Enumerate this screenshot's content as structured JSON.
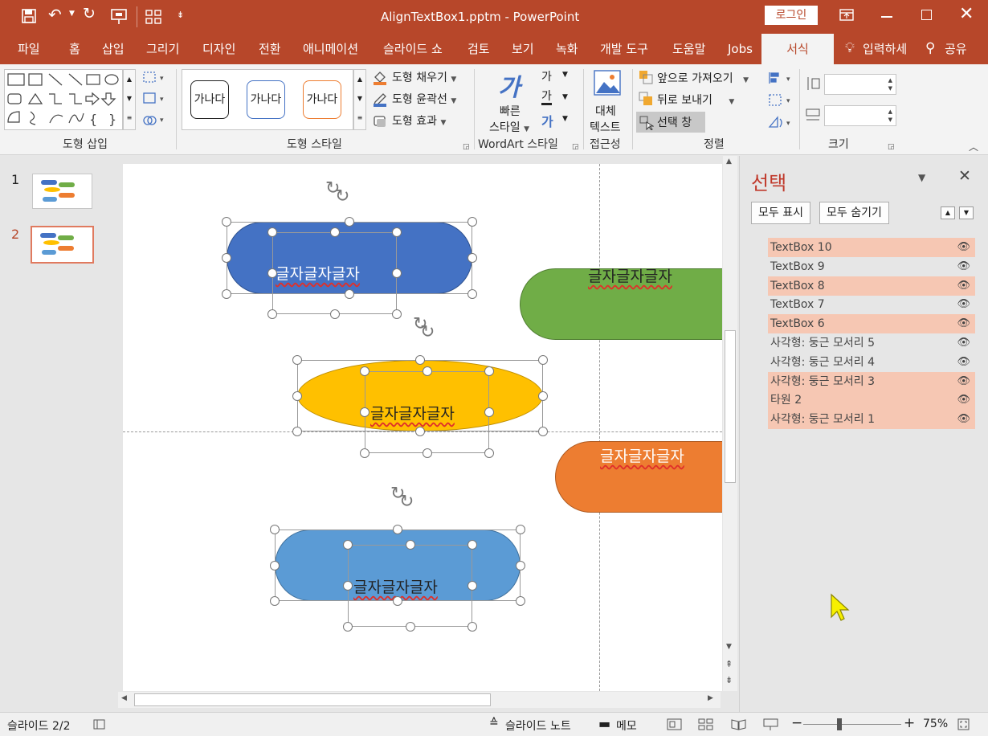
{
  "title": {
    "text": "AlignTextBox1.pptm  -  PowerPoint",
    "login": "로그인"
  },
  "tabs": [
    "파일",
    "홈",
    "삽입",
    "그리기",
    "디자인",
    "전환",
    "애니메이션",
    "슬라이드 쇼",
    "검토",
    "보기",
    "녹화",
    "개발 도구",
    "도움말",
    "Jobs",
    "서식"
  ],
  "tell_me": "입력하세",
  "share": "공유",
  "ribbon": {
    "groups": [
      "도형 삽입",
      "도형 스타일",
      "WordArt 스타일",
      "접근성",
      "정렬",
      "크기"
    ],
    "style_presets": [
      "가나다",
      "가나다",
      "가나다"
    ],
    "fill": "도형 채우기",
    "outline": "도형 윤곽선",
    "effects": "도형 효과",
    "quick_style_1": "빠른",
    "quick_style_2": "스타일",
    "wordart_glyph": "가",
    "alt_text_1": "대체",
    "alt_text_2": "텍스트",
    "bring_forward": "앞으로 가져오기",
    "send_backward": "뒤로 보내기",
    "selection_pane": "선택 창"
  },
  "thumbnails": [
    {
      "num": "1"
    },
    {
      "num": "2"
    }
  ],
  "slide": {
    "shapes": [
      {
        "text": "글자글자글자",
        "color": "#4472c4"
      },
      {
        "text": "글자글자글자",
        "color": "#70ad47"
      },
      {
        "text": "글자글자글자",
        "color": "#ffc000"
      },
      {
        "text": "글자글자글자",
        "color": "#ed7d31"
      },
      {
        "text": "글자글자글자",
        "color": "#5b9bd5"
      }
    ]
  },
  "pane": {
    "title": "선택",
    "show_all": "모두 표시",
    "hide_all": "모두 숨기기",
    "items": [
      {
        "label": "TextBox 10",
        "selected": true
      },
      {
        "label": "TextBox 9",
        "selected": false
      },
      {
        "label": "TextBox 8",
        "selected": true
      },
      {
        "label": "TextBox 7",
        "selected": false
      },
      {
        "label": "TextBox 6",
        "selected": true
      },
      {
        "label": "사각형: 둥근 모서리 5",
        "selected": false
      },
      {
        "label": "사각형: 둥근 모서리 4",
        "selected": false
      },
      {
        "label": "사각형: 둥근 모서리 3",
        "selected": true
      },
      {
        "label": "타원 2",
        "selected": true
      },
      {
        "label": "사각형: 둥근 모서리 1",
        "selected": true
      }
    ]
  },
  "status": {
    "slide_info": "슬라이드 2/2",
    "notes": "슬라이드 노트",
    "comments": "메모",
    "zoom": "75%"
  },
  "colors": {
    "accent": "#b7472a",
    "selected_row": "#f6c7b3"
  }
}
